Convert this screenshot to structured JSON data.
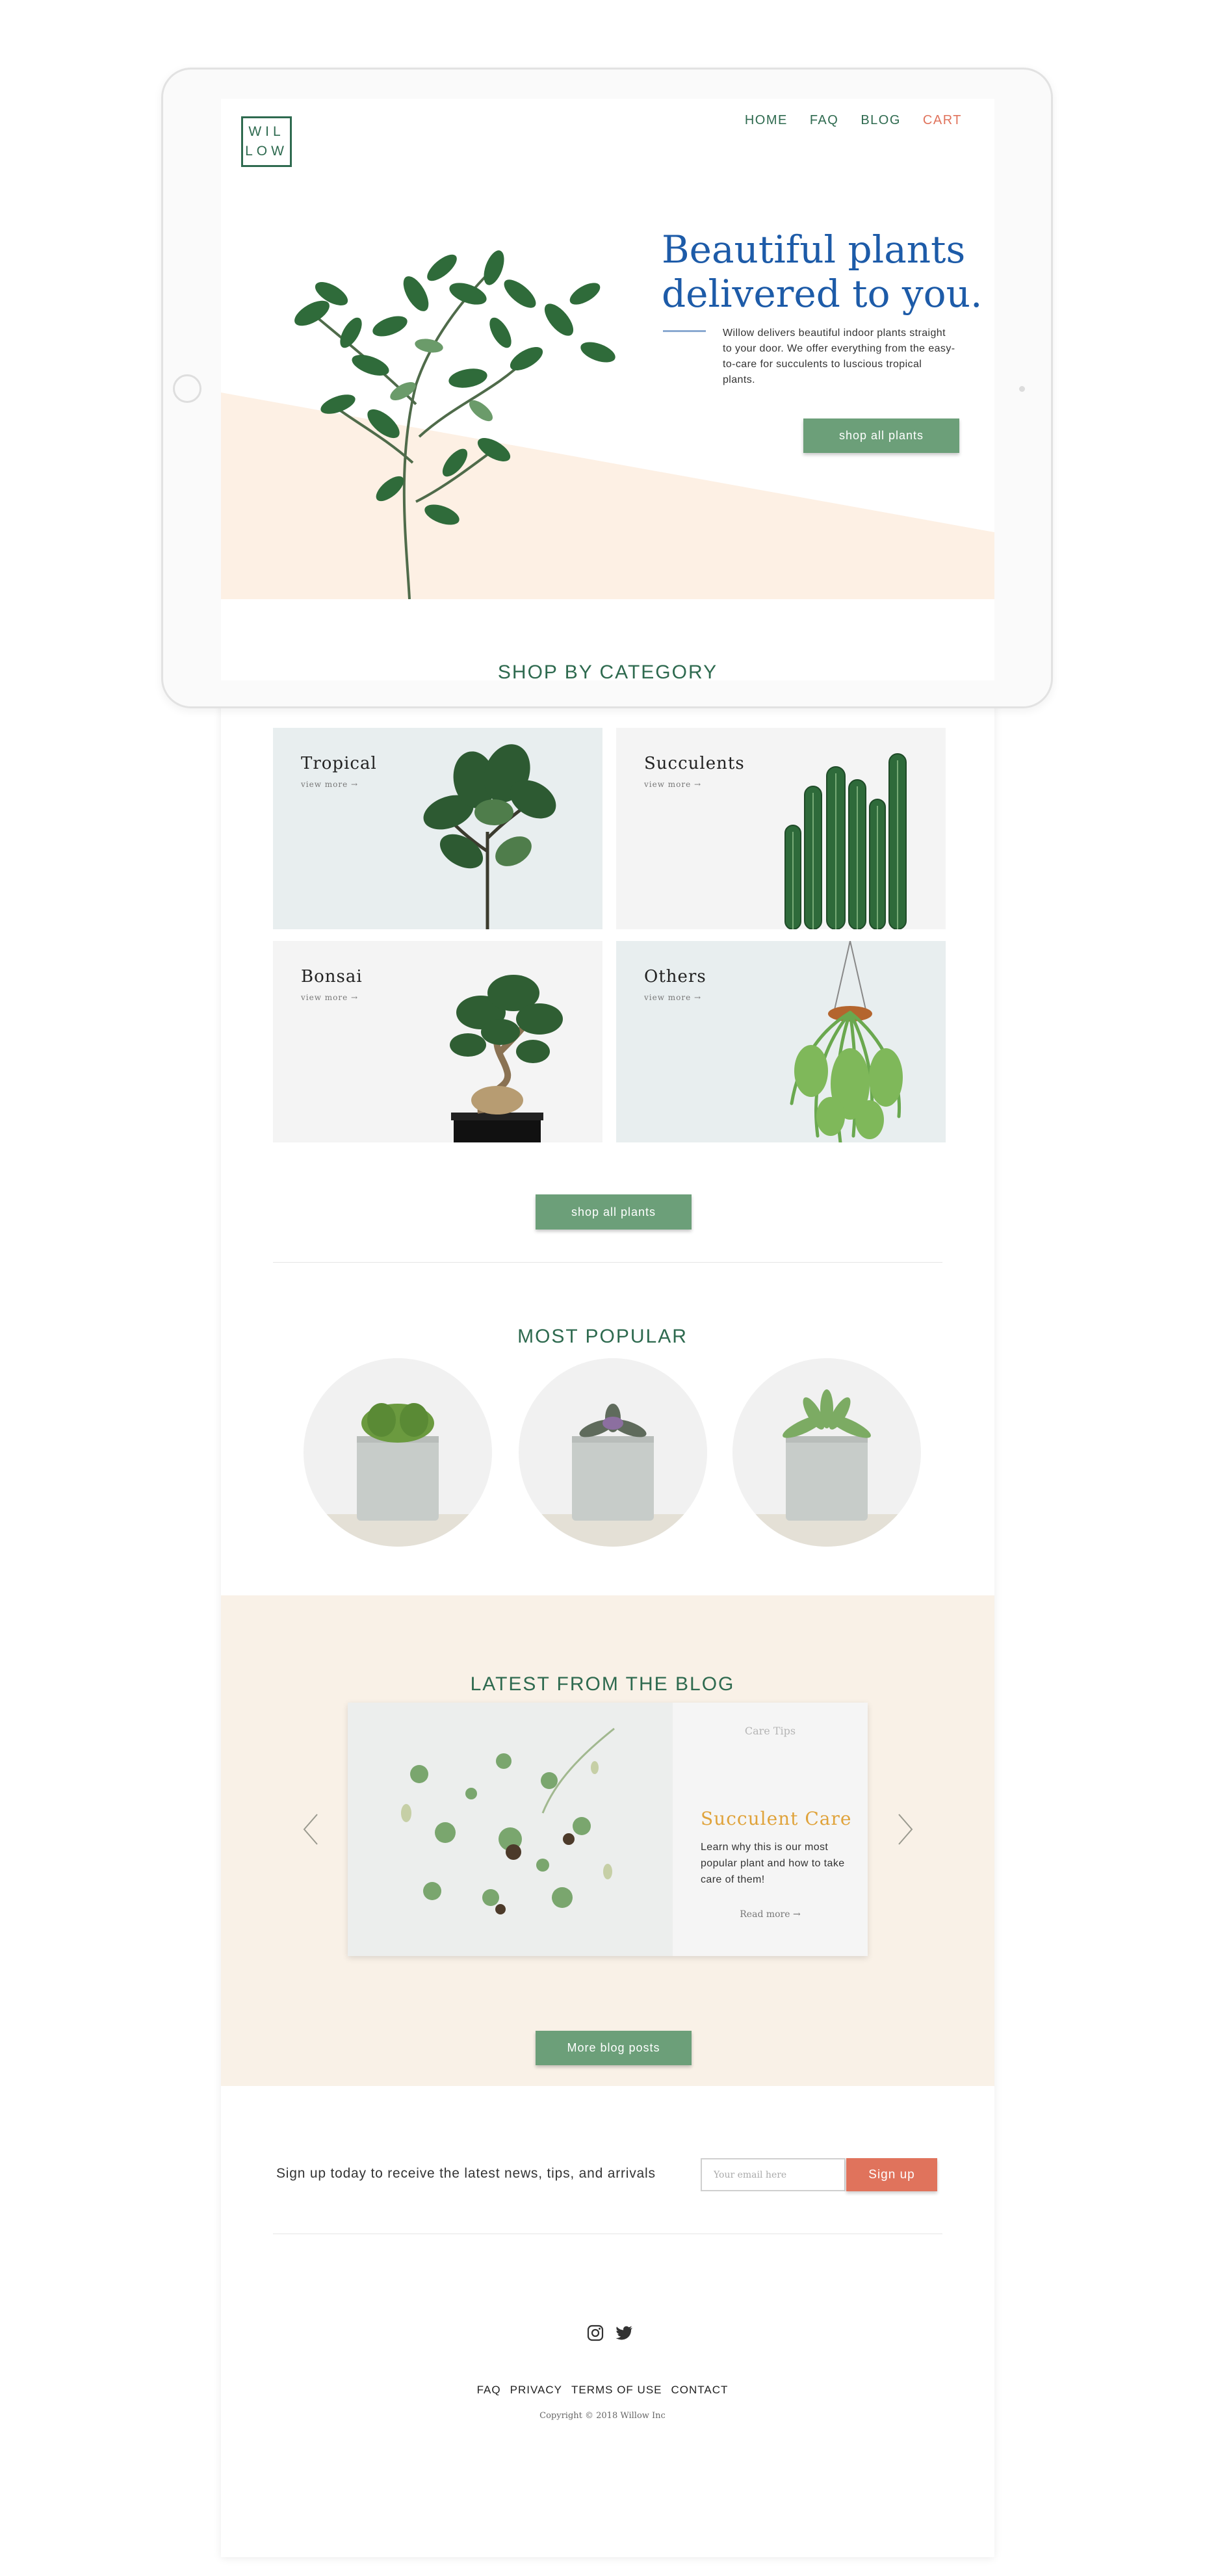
{
  "brand": {
    "logo_line1": "WIL",
    "logo_line2": "LOW"
  },
  "nav": {
    "home": "HOME",
    "faq": "FAQ",
    "blog": "BLOG",
    "cart": "CART"
  },
  "hero": {
    "title": "Beautiful plants delivered to you.",
    "body": "Willow delivers beautiful indoor plants straight to your door. We offer everything from the easy-to-care for succulents to luscious tropical plants.",
    "cta": "shop all plants"
  },
  "shop": {
    "title": "SHOP BY CATEGORY",
    "categories": [
      {
        "name": "Tropical",
        "link": "view more →"
      },
      {
        "name": "Succulents",
        "link": "view more →"
      },
      {
        "name": "Bonsai",
        "link": "view more →"
      },
      {
        "name": "Others",
        "link": "view more →"
      }
    ],
    "cta": "shop all plants"
  },
  "popular": {
    "title": "MOST POPULAR"
  },
  "blog": {
    "title": "LATEST FROM THE BLOG",
    "post": {
      "tag": "Care Tips",
      "title": "Succulent Care",
      "body": "Learn why this is our most popular plant and how to take care of them!",
      "link": "Read more →"
    },
    "cta": "More blog posts"
  },
  "newsletter": {
    "copy": "Sign up today to receive the latest news, tips, and arrivals",
    "placeholder": "Your email here",
    "button": "Sign up"
  },
  "footer": {
    "links": [
      "FAQ",
      "PRIVACY",
      "TERMS OF USE",
      "CONTACT"
    ],
    "copyright": "Copyright © 2018 Willow Inc"
  },
  "colors": {
    "brand_green": "#2e6a4f",
    "button_green": "#6c9f79",
    "hero_blue": "#1d5ba8",
    "accent_coral": "#e0735c",
    "blog_gold": "#e0a33b",
    "peach": "#fdf0e4",
    "cream": "#f9f1e7"
  }
}
